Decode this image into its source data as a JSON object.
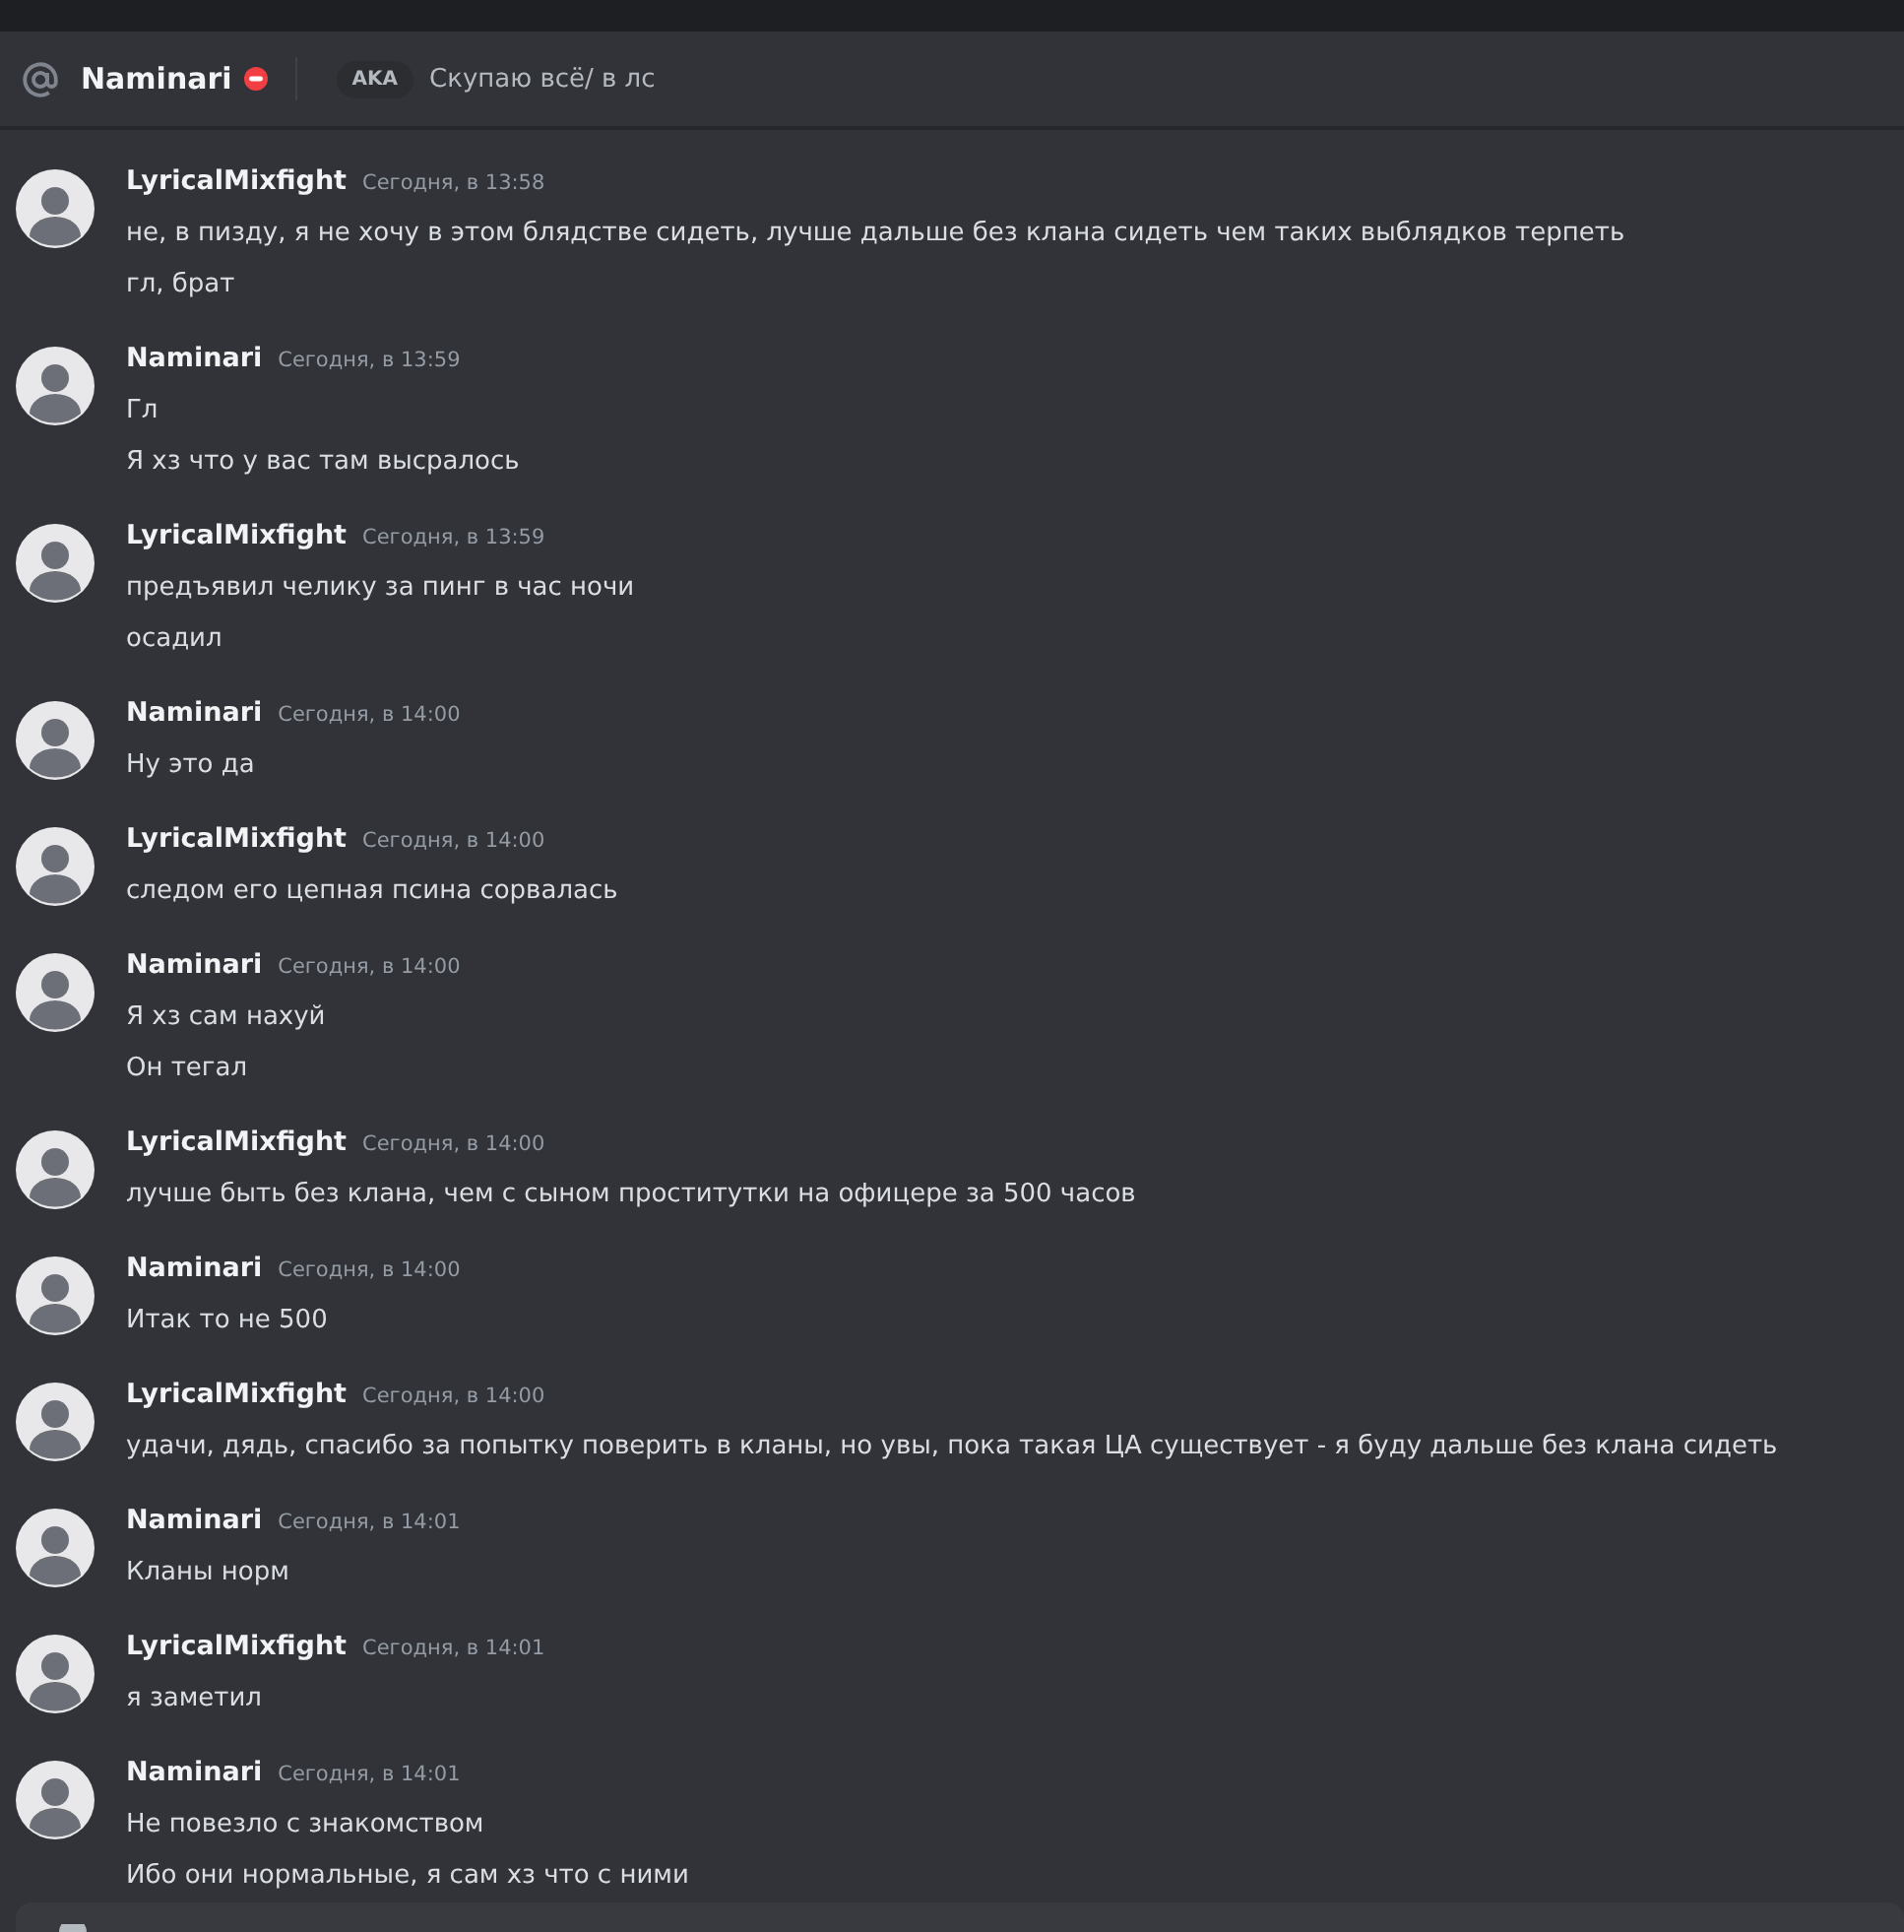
{
  "header": {
    "name": "Naminari",
    "do_not_disturb": true,
    "aka_tag": "AKA",
    "aka_text": "Скупаю всё/ в лс"
  },
  "messages": [
    {
      "author": "LyricalMixfight",
      "time": "Сегодня, в 13:58",
      "lines": [
        "не, в пизду, я не хочу в этом блядстве сидеть, лучше дальше без клана сидеть чем таких выблядков терпеть",
        "гл, брат"
      ]
    },
    {
      "author": "Naminari",
      "time": "Сегодня, в 13:59",
      "lines": [
        "Гл",
        "Я хз что у вас там высралось"
      ]
    },
    {
      "author": "LyricalMixfight",
      "time": "Сегодня, в 13:59",
      "lines": [
        "предъявил челику за пинг в час ночи",
        "осадил"
      ]
    },
    {
      "author": "Naminari",
      "time": "Сегодня, в 14:00",
      "lines": [
        "Ну это да"
      ]
    },
    {
      "author": "LyricalMixfight",
      "time": "Сегодня, в 14:00",
      "lines": [
        "следом его цепная псина сорвалась"
      ]
    },
    {
      "author": "Naminari",
      "time": "Сегодня, в 14:00",
      "lines": [
        "Я хз сам нахуй",
        "Он тегал"
      ]
    },
    {
      "author": "LyricalMixfight",
      "time": "Сегодня, в 14:00",
      "lines": [
        "лучше быть без клана, чем с сыном проститутки на офицере за 500 часов"
      ]
    },
    {
      "author": "Naminari",
      "time": "Сегодня, в 14:00",
      "lines": [
        "Итак то не 500"
      ]
    },
    {
      "author": "LyricalMixfight",
      "time": "Сегодня, в 14:00",
      "lines": [
        "удачи, дядь, спасибо за попытку поверить в кланы, но увы, пока такая ЦА существует - я буду дальше без клана сидеть"
      ]
    },
    {
      "author": "Naminari",
      "time": "Сегодня, в 14:01",
      "lines": [
        "Кланы норм"
      ]
    },
    {
      "author": "LyricalMixfight",
      "time": "Сегодня, в 14:01",
      "lines": [
        "я заметил"
      ]
    },
    {
      "author": "Naminari",
      "time": "Сегодня, в 14:01",
      "lines": [
        "Не повезло с знакомством",
        "Ибо они нормальные, я сам хз что с ними"
      ]
    }
  ]
}
